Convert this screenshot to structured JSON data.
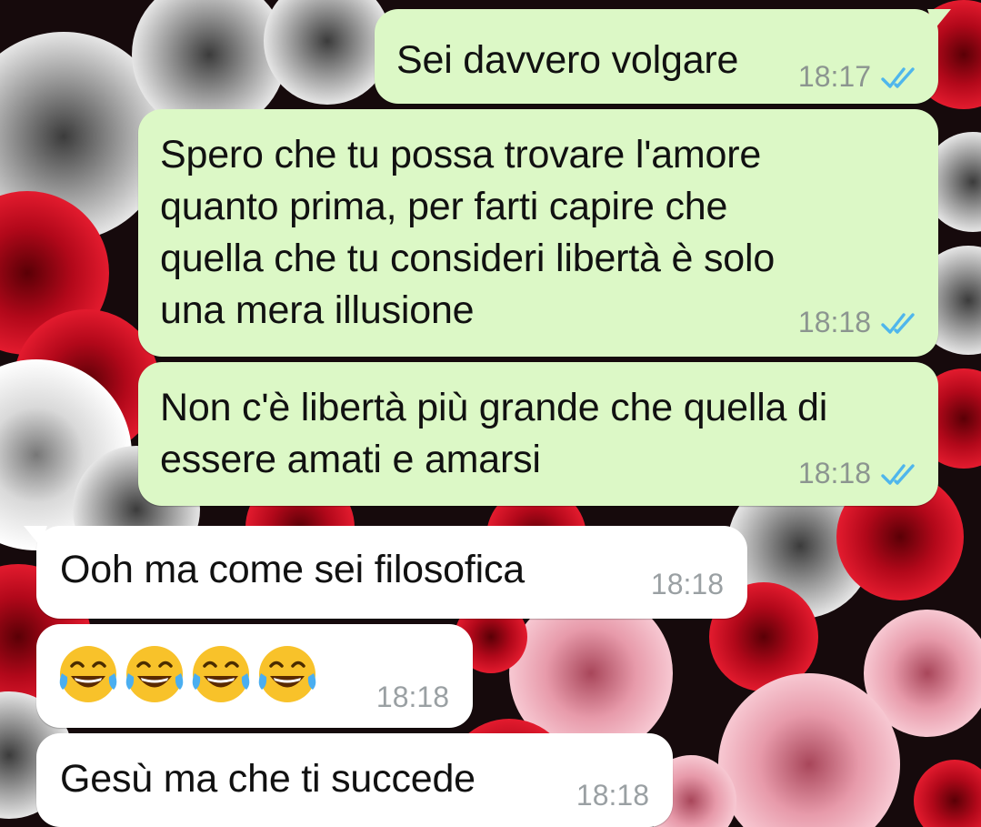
{
  "conversation": {
    "messages": [
      {
        "direction": "outgoing",
        "text": "Sei davvero volgare",
        "time": "18:17",
        "status": "read"
      },
      {
        "direction": "outgoing",
        "text": "Spero che tu possa trovare l'amore\nquanto prima, per farti capire che\nquella che tu consideri libertà è solo\nuna mera illusione",
        "time": "18:18",
        "status": "read"
      },
      {
        "direction": "outgoing",
        "text": "Non c'è libertà più grande che quella di\nessere amati e amarsi",
        "time": "18:18",
        "status": "read"
      },
      {
        "direction": "incoming",
        "text": "Ooh ma come sei filosofica",
        "time": "18:18"
      },
      {
        "direction": "incoming",
        "emoji": [
          "face-with-tears-of-joy",
          "face-with-tears-of-joy",
          "face-with-tears-of-joy",
          "face-with-tears-of-joy"
        ],
        "time": "18:18"
      },
      {
        "direction": "incoming",
        "text": "Gesù ma che ti succede",
        "time": "18:18"
      }
    ]
  },
  "colors": {
    "outgoing_bubble": "#dcf8c6",
    "incoming_bubble": "#ffffff",
    "read_ticks": "#4fb6ec",
    "timestamp": "#8c9590"
  },
  "icons": {
    "read_receipt": "double-check-icon",
    "emoji": "face-with-tears-of-joy"
  }
}
